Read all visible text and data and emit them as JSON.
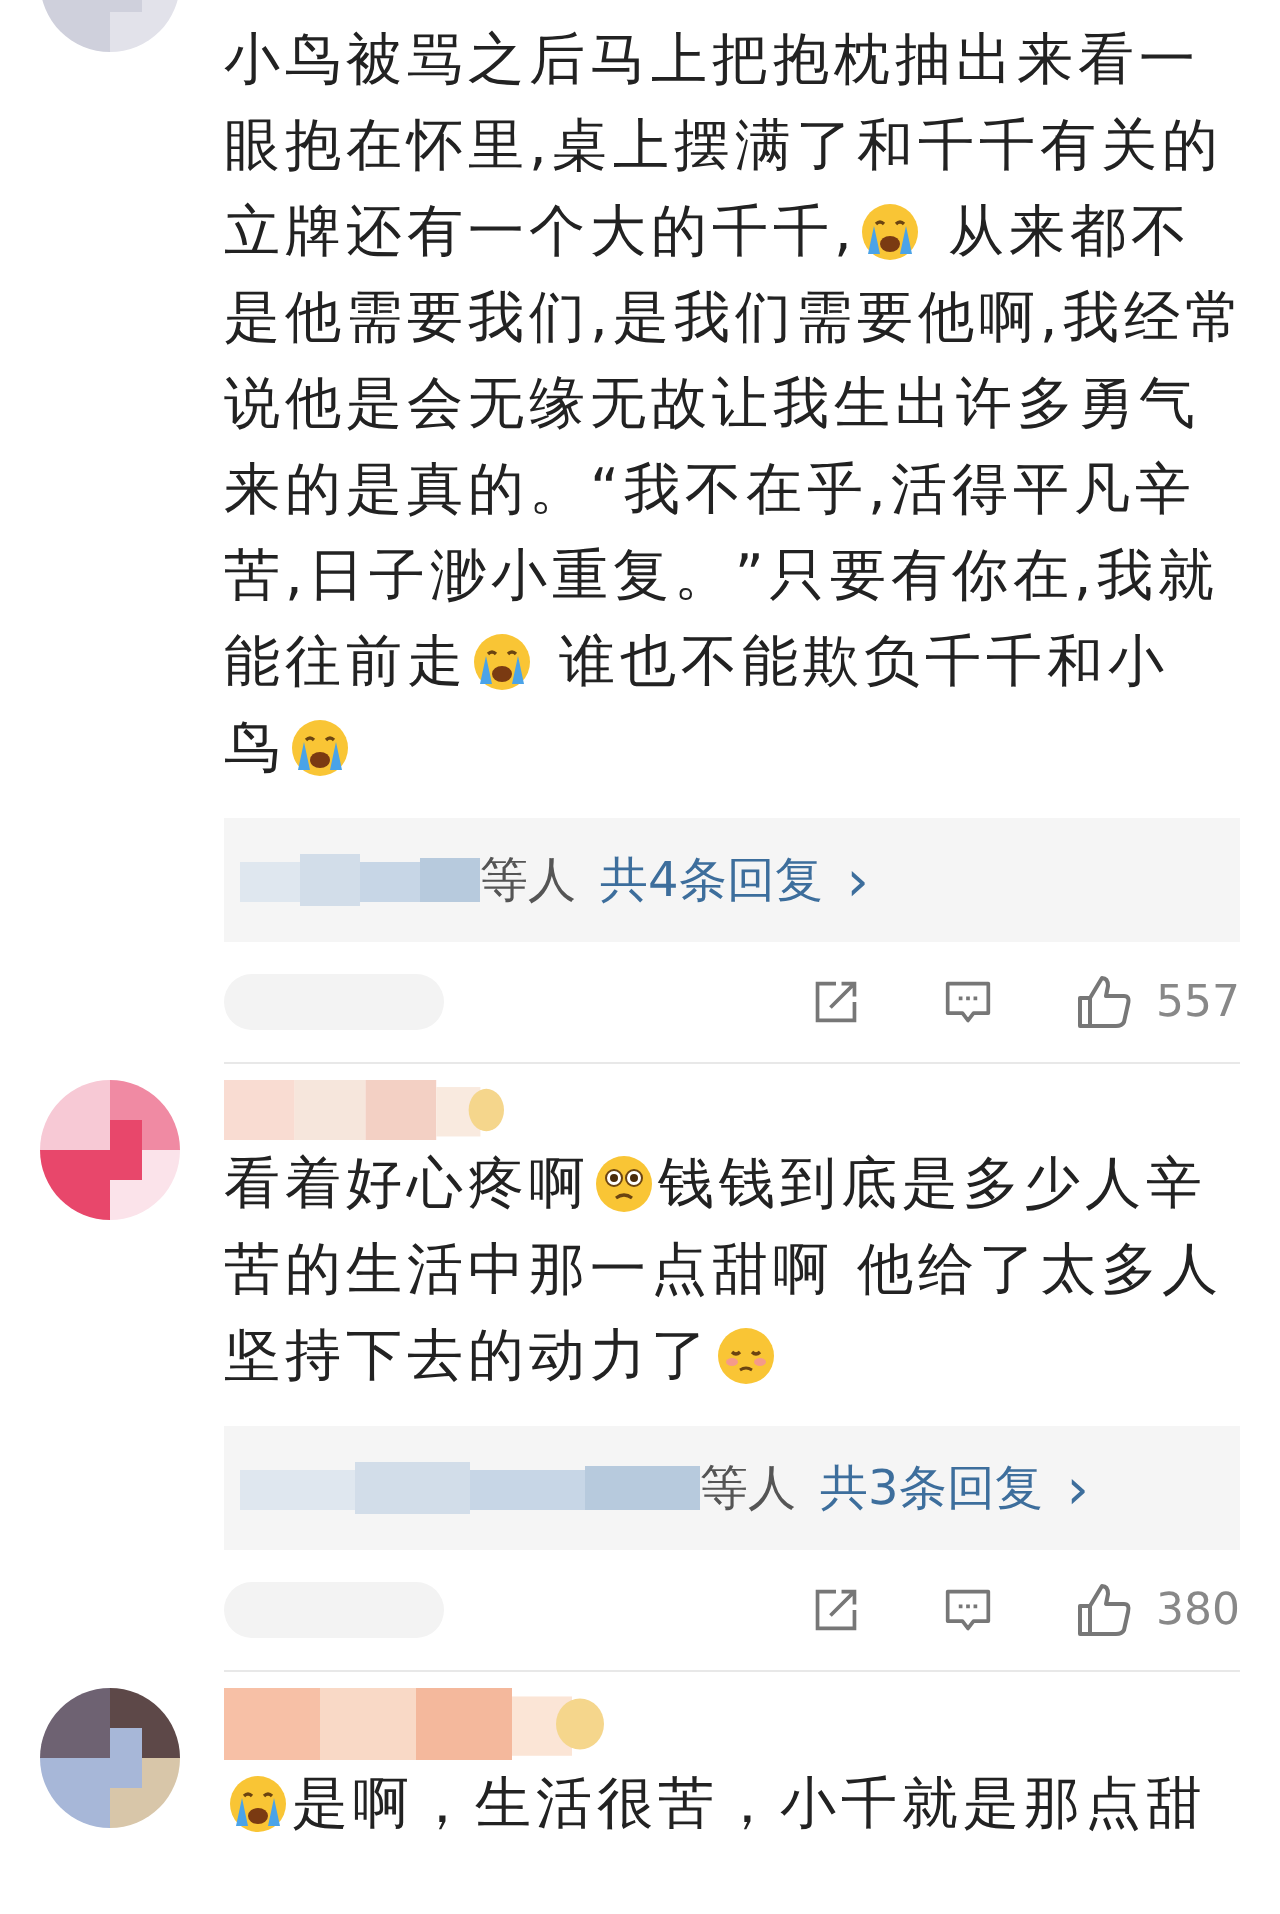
{
  "comments": [
    {
      "kind": "continued",
      "lines": [
        [
          {
            "kind": "text",
            "text": "小鸟被骂之后马上把抱枕抽出来看一"
          }
        ],
        [
          {
            "kind": "text",
            "text": "眼抱在怀里,桌上摆满了和千千有关的"
          }
        ],
        [
          {
            "kind": "text",
            "text": "立牌还有一个大的千千,"
          },
          {
            "kind": "crying"
          },
          {
            "kind": "text",
            "text": " 从来都不"
          }
        ],
        [
          {
            "kind": "text",
            "text": "是他需要我们,是我们需要他啊,我经常"
          }
        ],
        [
          {
            "kind": "text",
            "text": "说他是会无缘无故让我生出许多勇气"
          }
        ],
        [
          {
            "kind": "text",
            "text": "来的是真的。“我不在乎,活得平凡辛"
          }
        ],
        [
          {
            "kind": "text",
            "text": "苦,日子渺小重复。”只要有你在,我就"
          }
        ],
        [
          {
            "kind": "text",
            "text": "能往前走"
          },
          {
            "kind": "crying"
          },
          {
            "kind": "text",
            "text": " 谁也不能欺负千千和小"
          }
        ],
        [
          {
            "kind": "text",
            "text": "鸟"
          },
          {
            "kind": "crying"
          }
        ]
      ],
      "replies": {
        "suffix": "等人",
        "link": "共4条回复",
        "chevron": "›"
      },
      "likes": "557"
    },
    {
      "kind": "full",
      "lines": [
        [
          {
            "kind": "text",
            "text": "看着好心疼啊"
          },
          {
            "kind": "pleading"
          },
          {
            "kind": "text",
            "text": "钱钱到底是多少人辛"
          }
        ],
        [
          {
            "kind": "text",
            "text": "苦的生活中那一点甜啊 他给了太多人"
          }
        ],
        [
          {
            "kind": "text",
            "text": "坚持下去的动力了"
          },
          {
            "kind": "sad"
          }
        ]
      ],
      "replies": {
        "suffix": "等人",
        "link": "共3条回复",
        "chevron": "›"
      },
      "likes": "380"
    },
    {
      "kind": "full",
      "lines": [
        [
          {
            "kind": "crying"
          },
          {
            "kind": "text",
            "text": "是啊，生活很苦，小千就是那点甜"
          }
        ]
      ]
    }
  ]
}
